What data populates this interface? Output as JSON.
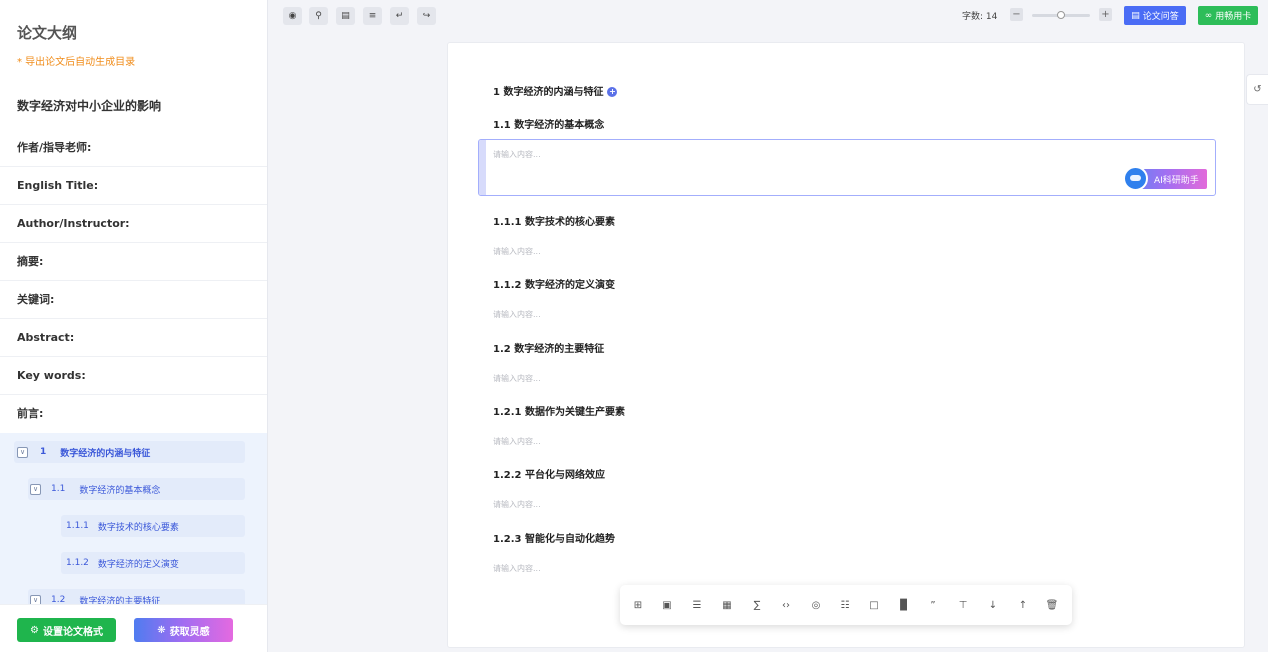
{
  "sidebar": {
    "title": "论文大纲",
    "note": "* 导出论文后自动生成目录",
    "paper_title": "数字经济对中小企业的影响",
    "fields": [
      "作者/指导老师:",
      "English Title:",
      "Author/Instructor:",
      "摘要:",
      "关键词:",
      "Abstract:",
      "Key words:",
      "前言:"
    ],
    "tree": [
      {
        "num": "1",
        "label": "数字经济的内涵与特征"
      },
      {
        "num": "1.1",
        "label": "数字经济的基本概念"
      },
      {
        "num": "1.1.1",
        "label": "数字技术的核心要素"
      },
      {
        "num": "1.1.2",
        "label": "数字经济的定义演变"
      },
      {
        "num": "1.2",
        "label": "数字经济的主要特征"
      }
    ],
    "format_button": "设置论文格式",
    "inspire_button": "获取灵感"
  },
  "topbar": {
    "icons": [
      "eye-icon",
      "search-icon",
      "layout-icon",
      "outline-icon",
      "undo-icon",
      "redo-icon"
    ],
    "word_count_label": "字数: 14",
    "zoom_minus": "−",
    "zoom_plus": "+",
    "zoom_level": 0.5,
    "qa_button": "论文问答",
    "card_button": "用畅用卡"
  },
  "document": {
    "headings": [
      "1 数字经济的内涵与特征",
      "1.1 数字经济的基本概念",
      "1.1.1 数字技术的核心要素",
      "1.1.2 数字经济的定义演变",
      "1.2 数字经济的主要特征",
      "1.2.1 数据作为关键生产要素",
      "1.2.2 平台化与网络效应",
      "1.2.3 智能化与自动化趋势"
    ],
    "placeholder": "请输入内容...",
    "ai_button": "AI科研助手"
  },
  "bottom_toolbar": {
    "icons": [
      "add-block-icon",
      "image-icon",
      "list-icon",
      "table-icon",
      "formula-icon",
      "code-icon",
      "idea-icon",
      "diagram-icon",
      "mark-icon",
      "bar-chart-icon",
      "quote-icon",
      "split-icon",
      "move-down-icon",
      "move-up-icon",
      "delete-icon"
    ]
  },
  "colors": {
    "accent_blue": "#4a6cf5",
    "green": "#1fb54d",
    "orange_note": "#f08c1a",
    "tree_text": "#3b58d9"
  }
}
